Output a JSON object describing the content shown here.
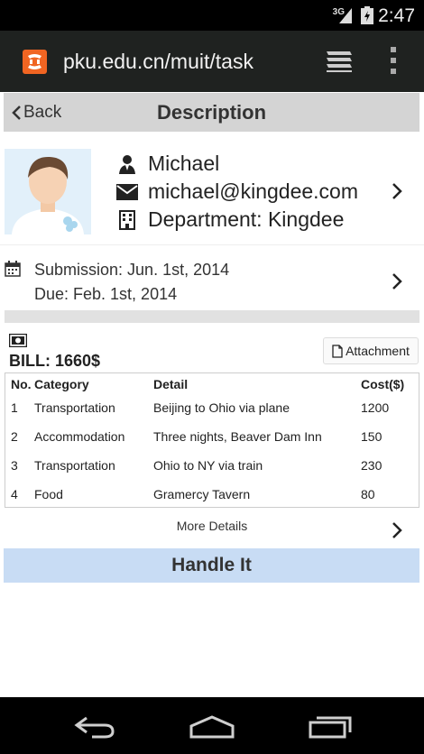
{
  "status": {
    "network": "3G",
    "time": "2:47"
  },
  "browser": {
    "url": "pku.edu.cn/muit/task"
  },
  "header": {
    "back_label": "Back",
    "title": "Description"
  },
  "profile": {
    "name": "Michael",
    "email": "michael@kingdee.com",
    "department": "Department: Kingdee"
  },
  "dates": {
    "submission": "Submission: Jun. 1st, 2014",
    "due": "Due: Feb. 1st, 2014"
  },
  "bill": {
    "total": "BILL: 1660$",
    "attachment_label": "Attachment",
    "columns": [
      "No.",
      "Category",
      "Detail",
      "Cost($)"
    ],
    "rows": [
      [
        "1",
        "Transportation",
        "Beijing to Ohio via plane",
        "1200"
      ],
      [
        "2",
        "Accommodation",
        "Three nights, Beaver Dam Inn",
        "150"
      ],
      [
        "3",
        "Transportation",
        "Ohio to NY via train",
        "230"
      ],
      [
        "4",
        "Food",
        "Gramercy Tavern",
        "80"
      ]
    ],
    "more_label": "More Details"
  },
  "action": {
    "handle_label": "Handle It"
  },
  "colors": {
    "title_bar": "#d4d4d4",
    "handle_button": "#c8dcf4",
    "browser_bar": "#1f2220",
    "logo": "#f06522"
  },
  "icons": {
    "browser": [
      "xampp-logo-icon",
      "tabs-icon",
      "overflow-menu-icon"
    ],
    "profile": [
      "user-icon",
      "envelope-icon",
      "building-icon"
    ],
    "nav": [
      "back-nav-icon",
      "home-nav-icon",
      "recents-nav-icon"
    ]
  }
}
